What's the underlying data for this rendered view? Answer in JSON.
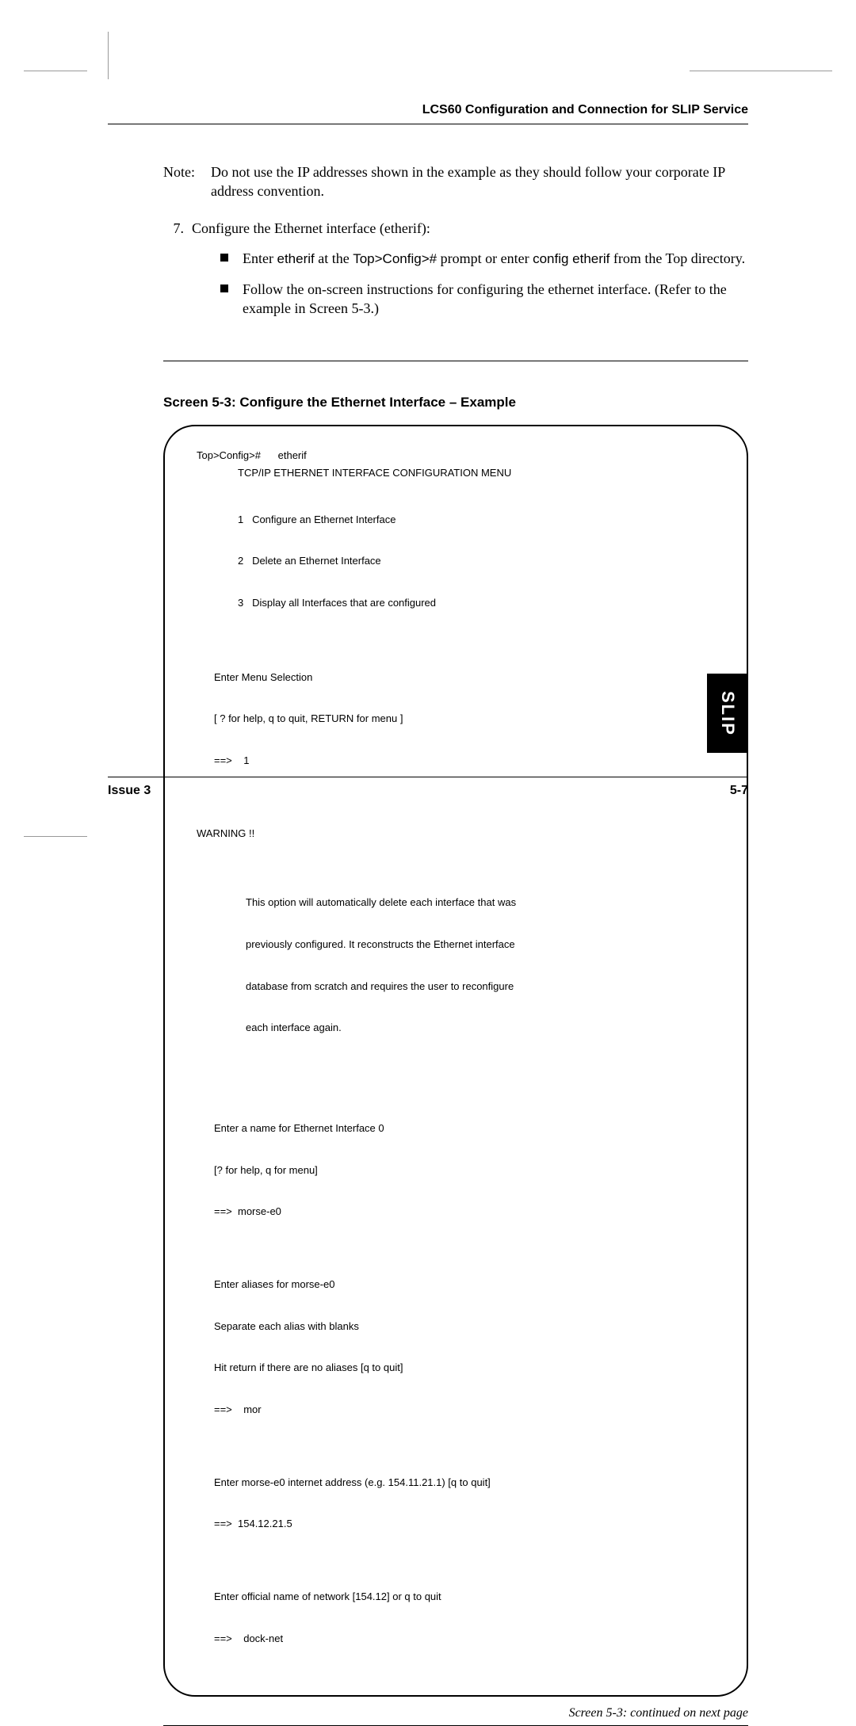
{
  "header": {
    "running_head": "LCS60 Configuration and Connection for SLIP Service"
  },
  "note": {
    "label": "Note:",
    "text": "Do not use the IP addresses shown in the example as they should follow your corporate IP address convention."
  },
  "step": {
    "num": "7.",
    "text": "Configure the Ethernet interface (etherif):",
    "sub1_a": "Enter ",
    "sub1_b": "etherif",
    "sub1_c": "  at the ",
    "sub1_d": "Top>Config>#",
    "sub1_e": " prompt or enter ",
    "sub1_f": "config etherif",
    "sub1_g": " from the Top directory.",
    "sub2": "Follow the on-screen instructions for configuring the ethernet interface. (Refer to the example in Screen 5-3.)"
  },
  "screen_title": "Screen 5-3:  Configure the Ethernet Interface – Example",
  "screen": {
    "l1": "Top>Config>#      etherif",
    "l2": "TCP/IP ETHERNET INTERFACE CONFIGURATION MENU",
    "l3": "1   Configure an Ethernet Interface",
    "l4": "2   Delete an Ethernet Interface",
    "l5": "3   Display all Interfaces that are configured",
    "l6": "Enter Menu Selection",
    "l7": "[ ? for help, q to quit, RETURN for menu ]",
    "l8": "==>    1",
    "l9": "WARNING !!",
    "l10": "This option will automatically delete each interface that was",
    "l11": "previously configured. It reconstructs the Ethernet interface",
    "l12": "database from scratch and requires the user to reconfigure",
    "l13": "each interface again.",
    "l14": "Enter a name for Ethernet Interface 0",
    "l15": "[? for help, q for menu]",
    "l16": "==>  morse-e0",
    "l17": "Enter aliases for morse-e0",
    "l18": "Separate each alias with blanks",
    "l19": "Hit return if there are no aliases [q to quit]",
    "l20": "==>    mor",
    "l21": "Enter morse-e0 internet address (e.g. 154.11.21.1) [q to quit]",
    "l22": "==>  154.12.21.5",
    "l23": "Enter official name of network [154.12] or q to quit",
    "l24": "==>    dock-net"
  },
  "continued": "Screen 5-3: continued on next page",
  "footer": {
    "issue": "Issue 3",
    "page": "5-7"
  },
  "tab": "SLIP"
}
